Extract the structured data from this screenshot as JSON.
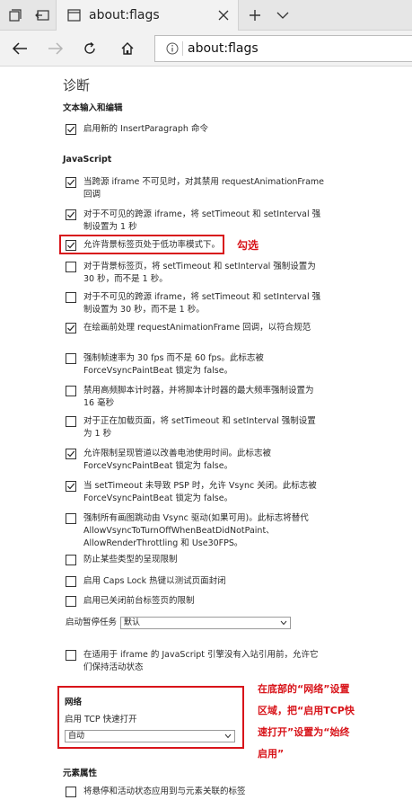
{
  "browser": {
    "tab_title": "about:flags",
    "address": "about:flags"
  },
  "page": {
    "heading": "诊断",
    "text_section": {
      "title": "文本输入和编辑",
      "items": [
        {
          "label": "启用新的 InsertParagraph 命令",
          "checked": true
        }
      ]
    },
    "js_section": {
      "title": "JavaScript",
      "items": [
        {
          "label": "当跨源 iframe 不可见时，对其禁用 requestAnimationFrame 回调",
          "checked": true
        },
        {
          "label": "对于不可见的跨源 iframe，将 setTimeout 和 setInterval 强制设置为 1 秒",
          "checked": true
        },
        {
          "label": "允许背景标签页处于低功率模式下。",
          "checked": true
        },
        {
          "label": "对于背景标签页，将 setTimeout 和 setInterval 强制设置为 30 秒，而不是 1 秒。",
          "checked": false
        },
        {
          "label": "对于不可见的跨源 iframe，将 setTimeout 和 setInterval 强制设置为 30 秒，而不是 1 秒。",
          "checked": false
        },
        {
          "label": "在绘画前处理 requestAnimationFrame 回调，以符合规范",
          "checked": true
        },
        {
          "label": "强制帧速率为 30 fps 而不是 60 fps。此标志被 ForceVsyncPaintBeat 锁定为 false。",
          "checked": false
        },
        {
          "label": "禁用高频脚本计时器，并将脚本计时器的最大频率强制设置为 16 毫秒",
          "checked": false
        },
        {
          "label": "对于正在加载页面，将 setTimeout 和 setInterval 强制设置为 1 秒",
          "checked": false
        },
        {
          "label": "允许限制呈现管道以改善电池使用时间。此标志被 ForceVsyncPaintBeat 锁定为 false。",
          "checked": true
        },
        {
          "label": "当 setTimeout 未导致 PSP 时，允许 Vsync 关闭。此标志被 ForceVsyncPaintBeat 锁定为 false。",
          "checked": true
        },
        {
          "label": "强制所有画图跳动由 Vsync 驱动(如果可用)。此标志将替代 AllowVsyncToTurnOffWhenBeatDidNotPaint、AllowRenderThrottling 和 Use30FPS。",
          "checked": false
        },
        {
          "label": "防止某些类型的呈现限制",
          "checked": false
        },
        {
          "label": "启用 Caps Lock 热键以测试页面封闭",
          "checked": false
        },
        {
          "label": "启用已关闭前台标签页的限制",
          "checked": false
        }
      ],
      "pause_label": "启动暂停任务",
      "pause_value": "默认",
      "iframe_item": {
        "label": "在适用于 iframe 的 JavaScript 引擎没有入站引用前，允许它们保持活动状态",
        "checked": false
      }
    },
    "network_section": {
      "title": "网络",
      "tcp_label": "启用 TCP 快速打开",
      "tcp_value": "自动"
    },
    "element_section": {
      "title": "元素属性",
      "items": [
        {
          "label": "将悬停和活动状态应用到与元素关联的标签",
          "checked": false
        }
      ]
    }
  },
  "annotations": {
    "check_note": "勾选",
    "network_note_line1": "在底部的“网络”设置",
    "network_note_line2": "区域，把“启用TCP快",
    "network_note_line3": "速打开”设置为“始终",
    "network_note_line4": "启用”",
    "color": "#d8141a"
  }
}
